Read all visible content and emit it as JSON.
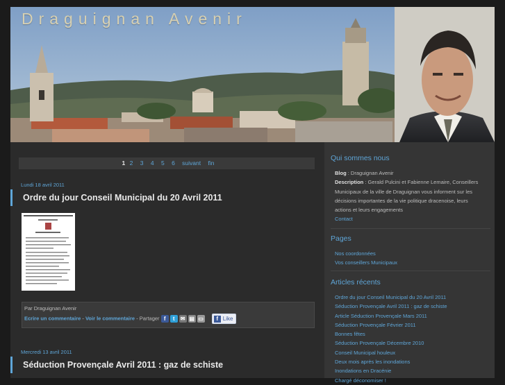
{
  "header": {
    "site_title": "Draguignan Avenir"
  },
  "pagination": {
    "current": "1",
    "pages": [
      "2",
      "3",
      "4",
      "5",
      "6"
    ],
    "next": "suivant",
    "last": "fin"
  },
  "posts": [
    {
      "date": "Lundi 18 avril 2011",
      "title": "Ordre du jour Conseil Municipal du 20 Avril 2011",
      "footer": {
        "by": "Par Draguignan Avenir",
        "write_comment": "Ecrire un commentaire",
        "view_comments": "Voir le commentaire",
        "share_label": "- Partager",
        "like_label": "Like"
      }
    },
    {
      "date": "Mercredi 13 avril 2011",
      "title": "Séduction Provençale Avril 2011 : gaz de schiste"
    }
  ],
  "sidebar": {
    "about": {
      "title": "Qui sommes nous",
      "blog_label": "Blog",
      "blog_value": ": Draguignan Avenir",
      "description_label": "Description",
      "description_value": ": Gerald Pulcini et Fabienne Lemaire, Conseillers Municipaux de la ville de Draguignan vous informent sur les décisions importantes de la vie politique dracenoise, leurs actions et leurs engagements",
      "contact": "Contact"
    },
    "pages": {
      "title": "Pages",
      "items": [
        "Nos coordonnées",
        "Vos conseillers Municipaux"
      ]
    },
    "recent": {
      "title": "Articles récents",
      "items": [
        "Ordre du jour Conseil Municipal du 20 Avril 2011",
        "Séduction Provençale Avril 2011 : gaz de schiste",
        "Article Séduction Provençale Mars 2011",
        "Séduction Provençale Février 2011",
        "Bonnes fêtes",
        "Séduction Provençale Décembre 2010",
        "Conseil Municipal houleux",
        "Deux mois après les inondations",
        "Inondations en Dracénie",
        "Chargé déconomiser !"
      ]
    }
  },
  "colors": {
    "accent": "#5fa6d8",
    "background": "#1b1b1b",
    "panel": "#2b2b2b",
    "sidebar": "#353535"
  }
}
